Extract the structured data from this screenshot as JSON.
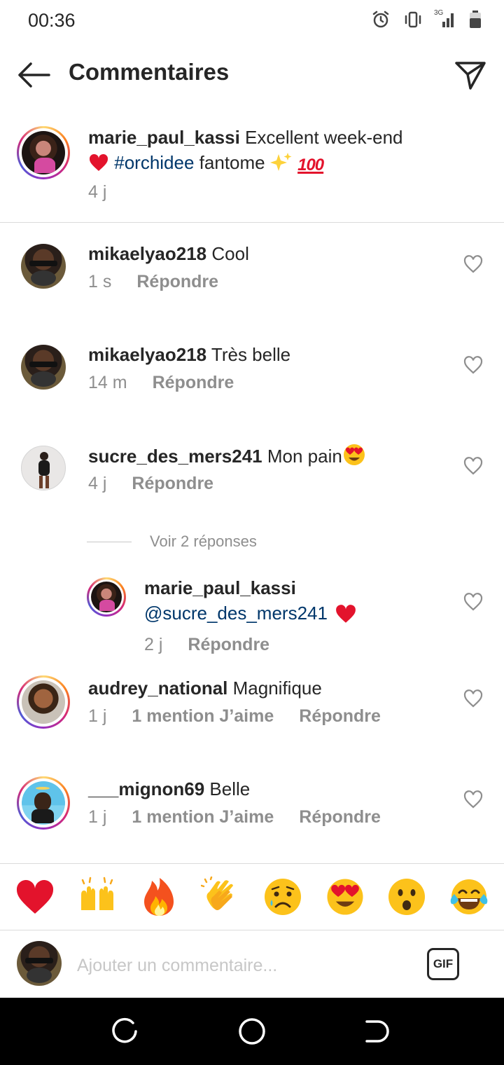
{
  "status_bar": {
    "time": "00:36",
    "network": "3G"
  },
  "header": {
    "title": "Commentaires"
  },
  "caption": {
    "username": "marie_paul_kassi",
    "text_before": "Excellent week-end",
    "hashtag": "#orchidee",
    "text_after": "fantome",
    "time": "4 j"
  },
  "comments": [
    {
      "username": "mikaelyao218",
      "text": "Cool",
      "time": "1 s",
      "reply": "Répondre"
    },
    {
      "username": "mikaelyao218",
      "text": "Très belle",
      "time": "14 m",
      "reply": "Répondre"
    },
    {
      "username": "sucre_des_mers241",
      "text": "Mon pain",
      "time": "4 j",
      "reply": "Répondre"
    },
    {
      "username": "audrey_national",
      "text": "Magnifique",
      "time": "1 j",
      "likes": "1 mention J’aime",
      "reply": "Répondre"
    },
    {
      "username": "___mignon69",
      "text": "Belle",
      "time": "1 j",
      "likes": "1 mention J’aime",
      "reply": "Répondre"
    }
  ],
  "view_replies": "Voir 2 réponses",
  "reply": {
    "username": "marie_paul_kassi",
    "mention": "@sucre_des_mers241",
    "time": "2 j",
    "reply": "Répondre"
  },
  "emoji_bar": [
    "red-heart",
    "raising-hands",
    "fire",
    "clapping-hands",
    "sad-face",
    "heart-eyes",
    "surprised-face",
    "tears-of-joy"
  ],
  "composer": {
    "placeholder": "Ajouter un commentaire...",
    "gif_label": "GIF"
  },
  "colors": {
    "text": "#262626",
    "secondary": "#8e8e8e",
    "link": "#00376b",
    "divider": "#dbdbdb"
  }
}
